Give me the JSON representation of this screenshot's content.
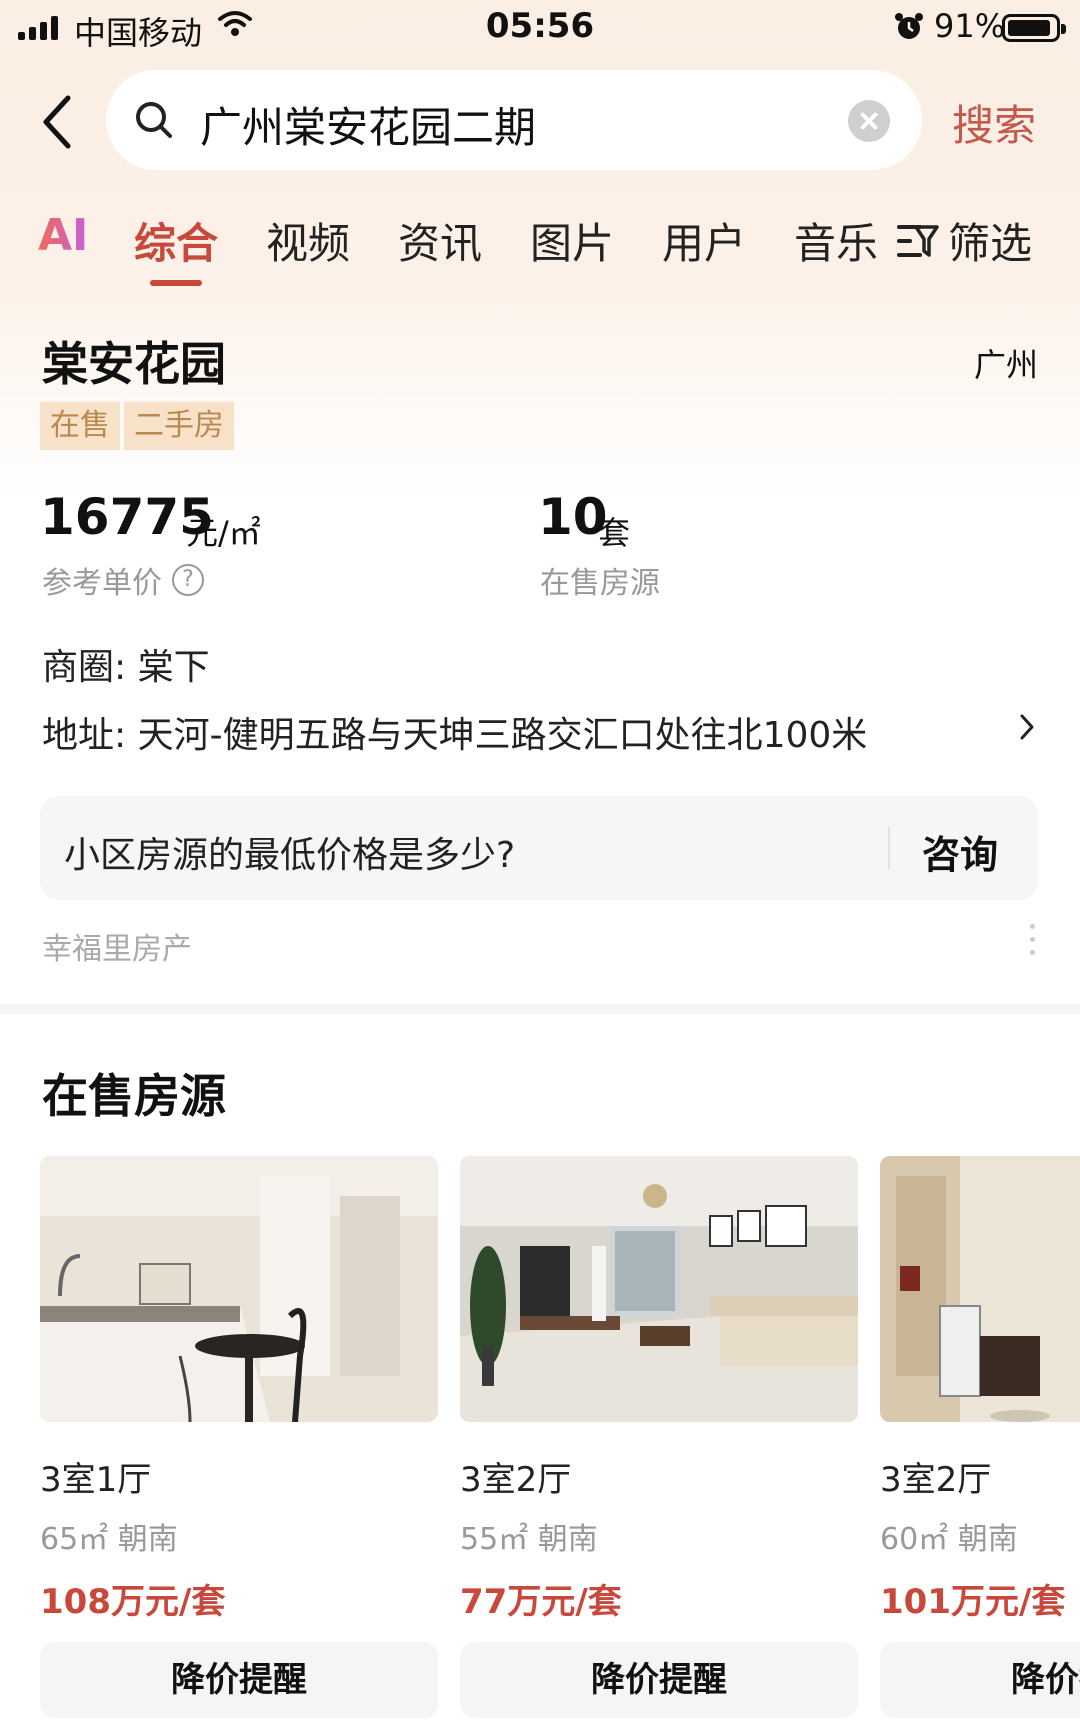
{
  "status_bar": {
    "carrier": "中国移动",
    "time": "05:56",
    "battery": "91%"
  },
  "search": {
    "query": "广州棠安花园二期",
    "button_label": "搜索"
  },
  "tabs": [
    {
      "label": "AI"
    },
    {
      "label": "综合",
      "active": true
    },
    {
      "label": "视频"
    },
    {
      "label": "资讯"
    },
    {
      "label": "图片"
    },
    {
      "label": "用户"
    },
    {
      "label": "音乐"
    }
  ],
  "filter_label": "筛选",
  "community": {
    "name": "棠安花园",
    "city": "广州",
    "tags": [
      "在售",
      "二手房"
    ],
    "price_value": "16775",
    "price_unit": "元/㎡",
    "price_label": "参考单价",
    "listing_count": "10",
    "listing_unit": "套",
    "listing_label": "在售房源",
    "business_area": "商圈: 棠下",
    "address": "地址: 天河-健明五路与天坤三路交汇口处往北100米"
  },
  "consult": {
    "question": "小区房源的最低价格是多少?",
    "button_label": "咨询",
    "source": "幸福里房产"
  },
  "listings_section": {
    "title": "在售房源",
    "items": [
      {
        "layout": "3室1厅",
        "meta": "65㎡ 朝南",
        "price": "108万元/套",
        "button": "降价提醒"
      },
      {
        "layout": "3室2厅",
        "meta": "55㎡ 朝南",
        "price": "77万元/套",
        "button": "降价提醒"
      },
      {
        "layout": "3室2厅",
        "meta": "60㎡ 朝南",
        "price": "101万元/套",
        "button": "降价提醒"
      }
    ]
  },
  "colors": {
    "accent": "#c9483c",
    "tag_bg": "#f7e2c9",
    "tag_text": "#b88a4d"
  }
}
